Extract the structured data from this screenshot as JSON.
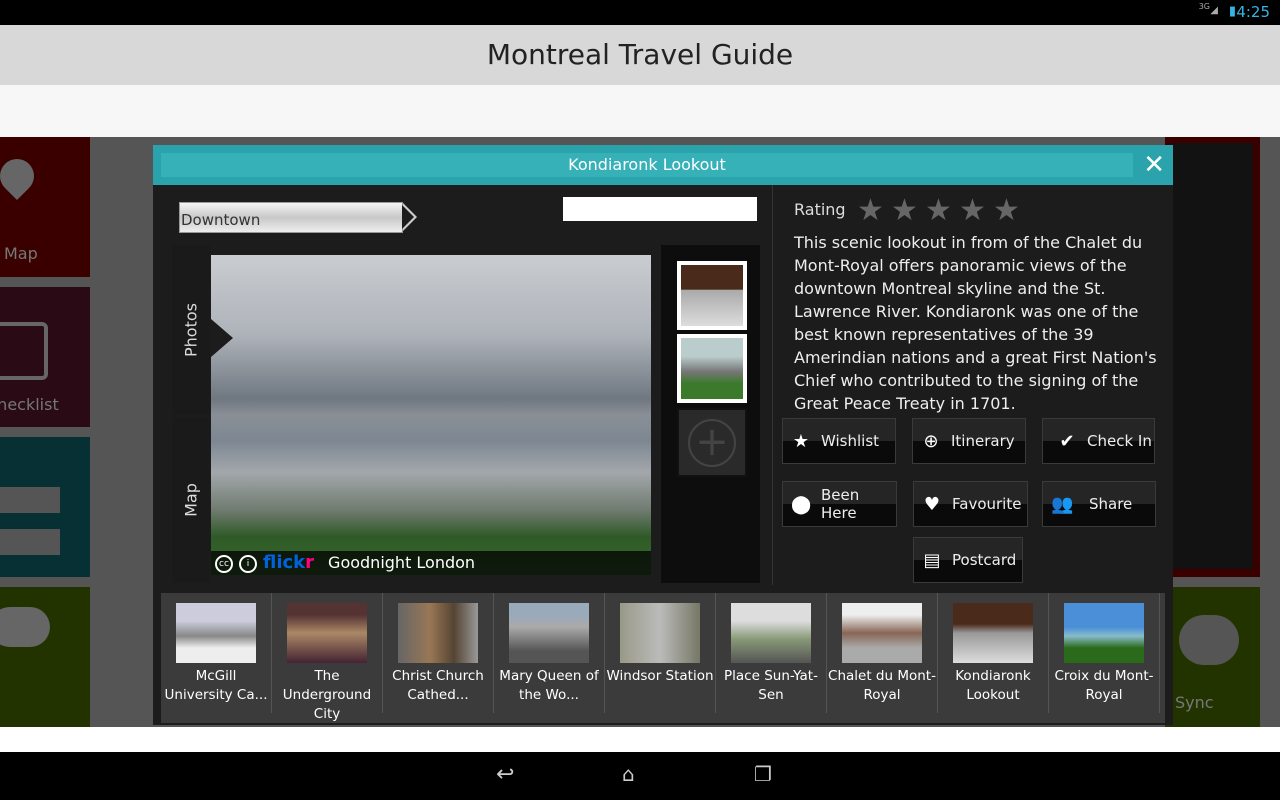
{
  "status": {
    "network": "3G",
    "time": "4:25"
  },
  "app": {
    "title": "Montreal Travel Guide"
  },
  "background_tiles": [
    {
      "label": "Map",
      "color": "#3a0000"
    },
    {
      "label": "Checklist",
      "color": "#2a0a14"
    },
    {
      "label": "",
      "color": "#063033"
    },
    {
      "label": "",
      "color": "#233300"
    },
    {
      "label": "Sync",
      "color": "#233300"
    }
  ],
  "modal": {
    "title": "Kondiaronk Lookout",
    "close_icon": "close-icon",
    "district": "Downtown",
    "search_value": "",
    "tabs": [
      {
        "label": "Photos",
        "active": true
      },
      {
        "label": "Map",
        "active": false
      }
    ],
    "photo": {
      "license_icons": [
        "cc-icon",
        "attribution-icon"
      ],
      "source": "flickr",
      "author": "Goodnight London"
    },
    "rating": {
      "label": "Rating",
      "value": 0,
      "max": 5
    },
    "description": "This scenic lookout in from of the Chalet du Mont-Royal offers panoramic views of the downtown Montreal skyline and the St. Lawrence River. Kondiaronk was one of the best known representatives of the 39 Amerindian nations and a great First Nation's Chief who contributed to the signing of the Great Peace Treaty in 1701.",
    "actions": [
      {
        "label": "Wishlist",
        "icon": "star-icon"
      },
      {
        "label": "Itinerary",
        "icon": "plus-circle-icon"
      },
      {
        "label": "Check In",
        "icon": "check-icon"
      },
      {
        "label": "Been Here",
        "icon": "map-pin-icon"
      },
      {
        "label": "Favourite",
        "icon": "heart-icon"
      },
      {
        "label": "Share",
        "icon": "people-icon"
      },
      {
        "label": "Postcard",
        "icon": "postcard-icon"
      }
    ],
    "places": [
      {
        "label": "McGill University Ca..."
      },
      {
        "label": "The Underground City"
      },
      {
        "label": "Christ Church Cathed..."
      },
      {
        "label": "Mary Queen of the Wo..."
      },
      {
        "label": "Windsor Station"
      },
      {
        "label": "Place Sun-Yat-Sen"
      },
      {
        "label": "Chalet du Mont-Royal"
      },
      {
        "label": "Kondiaronk Lookout"
      },
      {
        "label": "Croix du Mont-Royal"
      }
    ]
  }
}
